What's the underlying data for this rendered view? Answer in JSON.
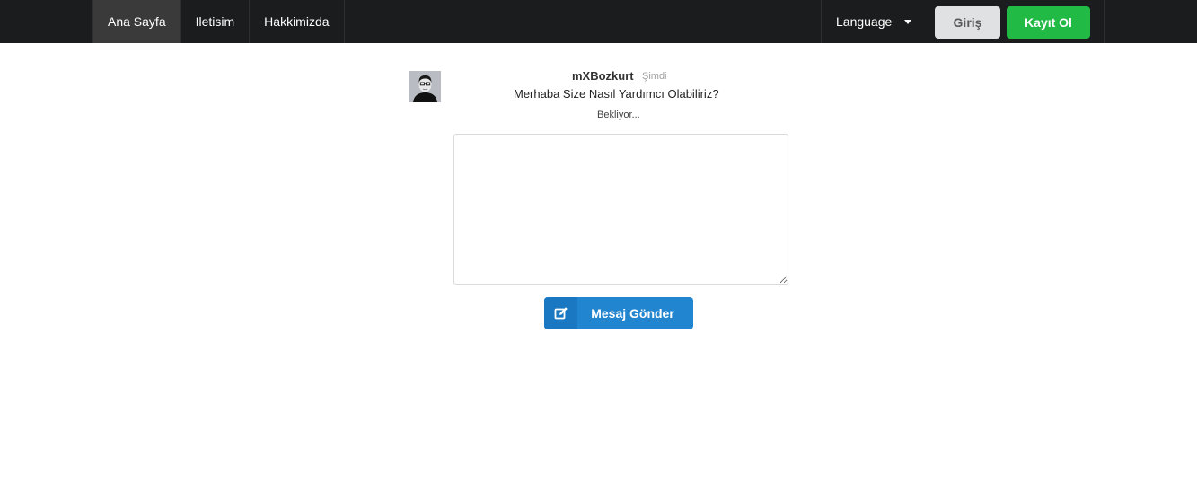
{
  "nav": {
    "items": [
      {
        "label": "Ana Sayfa",
        "active": true
      },
      {
        "label": "Iletisim",
        "active": false
      },
      {
        "label": "Hakkimizda",
        "active": false
      }
    ],
    "language_label": "Language",
    "login_label": "Giriş",
    "register_label": "Kayıt Ol"
  },
  "chat": {
    "username": "mXBozkurt",
    "time": "Şimdi",
    "message": "Merhaba Size Nasıl Yardımcı Olabiliriz?",
    "status": "Bekliyor..."
  },
  "compose": {
    "text_value": "",
    "send_label": "Mesaj Gönder"
  },
  "colors": {
    "navbar": "#1b1c1d",
    "register": "#21ba45",
    "send": "#2185d0"
  }
}
